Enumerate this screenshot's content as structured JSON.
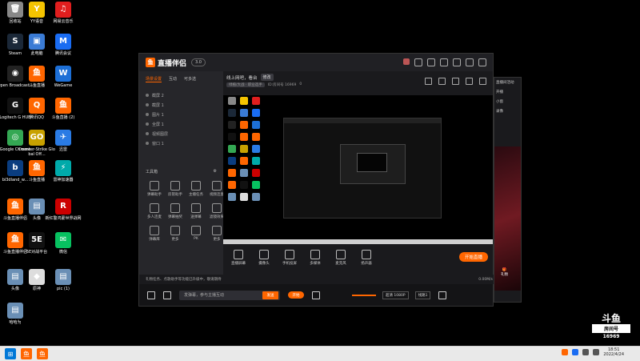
{
  "desktop": {
    "icons": [
      {
        "label": "回收站",
        "color": "#888",
        "glyph": "🗑"
      },
      {
        "label": "YY语音",
        "color": "#f5c400",
        "glyph": "Y"
      },
      {
        "label": "网易云音乐",
        "color": "#e01e1e",
        "glyph": "♫"
      },
      {
        "label": "Steam",
        "color": "#1b2838",
        "glyph": "S"
      },
      {
        "label": "此电脑",
        "color": "#3a7bd5",
        "glyph": "▣"
      },
      {
        "label": "腾讯会议",
        "color": "#1a6cf2",
        "glyph": "M"
      },
      {
        "label": "Open Broadcast...",
        "color": "#222",
        "glyph": "◉"
      },
      {
        "label": "斗鱼直播",
        "color": "#f60",
        "glyph": "鱼"
      },
      {
        "label": "WeGame",
        "color": "#1d6fd6",
        "glyph": "W"
      },
      {
        "label": "Logitech G HUB",
        "color": "#111",
        "glyph": "G"
      },
      {
        "label": "腾讯QQ",
        "color": "#f60",
        "glyph": "Q"
      },
      {
        "label": "斗鱼直播 (2)",
        "color": "#f60",
        "glyph": "鱼"
      },
      {
        "label": "Google Chrome",
        "color": "#34a853",
        "glyph": "◎"
      },
      {
        "label": "Counter-Strike Global Off...",
        "color": "#c8a100",
        "glyph": "GO"
      },
      {
        "label": "迅雷",
        "color": "#2a7be4",
        "glyph": "✈"
      },
      {
        "label": "bi3dland_w...",
        "color": "#0a3d80",
        "glyph": "b"
      },
      {
        "label": "斗鱼直播",
        "color": "#f60",
        "glyph": "鱼"
      },
      {
        "label": "雷神加速器",
        "color": "#0aa",
        "glyph": "⚡"
      },
      {
        "label": "斗鱼直播伴侣",
        "color": "#f60",
        "glyph": "鱼"
      },
      {
        "label": "头像",
        "color": "#6a8fb5",
        "glyph": "▤"
      },
      {
        "label": "新红警鸿蒙世界战网",
        "color": "#c00",
        "glyph": "R"
      },
      {
        "label": "斗鱼直播伴侣",
        "color": "#f60",
        "glyph": "鱼"
      },
      {
        "label": "5E对战平台",
        "color": "#111",
        "glyph": "5E"
      },
      {
        "label": "微信",
        "color": "#07c160",
        "glyph": "✉"
      },
      {
        "label": "头像",
        "color": "#6a8fb5",
        "glyph": "▤"
      },
      {
        "label": "原神",
        "color": "#ddd",
        "glyph": "◆"
      },
      {
        "label": "pic (1)",
        "color": "#6a8fb5",
        "glyph": "▤"
      },
      {
        "label": "哈哈为",
        "color": "#6a8fb5",
        "glyph": "▤"
      }
    ]
  },
  "app": {
    "title": "直播伴侣",
    "version": "3.0",
    "tabs": [
      "场景设置",
      "互动",
      "可多选"
    ],
    "layers": [
      "截屏 2",
      "截屏 1",
      "图片 1",
      "全屏 1",
      "视频图层",
      "窗口 1"
    ],
    "toolbox_title": "工具箱",
    "tools": [
      "弹幕助手",
      "房管助手",
      "主播任务",
      "视频连麦",
      "多人连麦",
      "弹幕抽奖",
      "送弹幕",
      "滤镜效果",
      "弹幕库",
      "更多",
      "PK",
      "更多"
    ],
    "stream_title": "线上网吧，看台",
    "stream_title_tag": "修改",
    "stream_category": "绿植/大战 · 职业选手",
    "stream_room": "ID:房间号 16969",
    "stream_hot": "0",
    "bottom_tools": [
      "直播屏幕",
      "摄像头",
      "手机投屏",
      "多媒体",
      "麦克风",
      "扬声器"
    ],
    "go_live_label": "开始直播",
    "notice_text": "礼物任务、点歌助手等功能已升级中，敬请期待",
    "notice_right": "0.00M/s",
    "danmu_placeholder": "发弹幕，参与主播互动",
    "danmu_send": "发送",
    "chip_label": "开始",
    "quality_label": "超清 1080P",
    "quality_label2": "线路1"
  },
  "side_window": {
    "header": "直播间活动",
    "btn1": "开播",
    "btn2": "小窗",
    "btn3": "录像",
    "gift": "礼物"
  },
  "watermark": {
    "logo": "斗鱼",
    "room_label": "房间号",
    "room_number": "16969"
  },
  "taskbar": {
    "time": "18:51",
    "date": "2022/4/24"
  }
}
